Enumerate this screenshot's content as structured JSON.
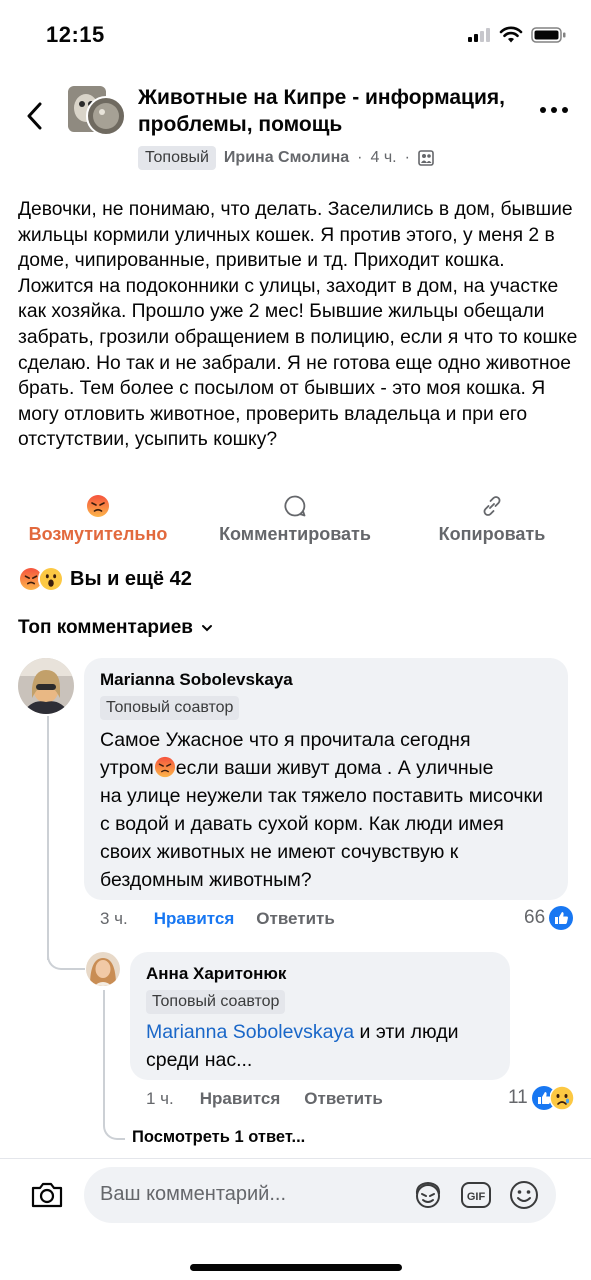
{
  "status_bar": {
    "time": "12:15"
  },
  "header": {
    "group_title": "Животные на Кипре - информация, проблемы, помощь",
    "badge": "Топовый",
    "author": "Ирина Смолина",
    "dot": "·",
    "time": "4 ч.",
    "icons": {
      "back": "chevron-left-icon",
      "more": "more-dots-icon",
      "audience": "group-audience-icon"
    }
  },
  "post": {
    "text": "Девочки, не понимаю, что делать. Заселились в дом, бывшие жильцы кормили уличных кошек. Я против этого, у меня 2 в доме, чипированные, привитые и тд. Приходит кошка. Ложится на подоконники с улицы, заходит в дом, на участке как хозяйка. Прошло уже 2 мес! Бывшие жильцы обещали забрать, грозили обращением в полицию, если я что то кошке сделаю. Но так и не забрали. Я не готова еще одно животное брать. Тем более с посылом от бывших - это моя кошка. Я могу отловить животное, проверить владельца и при его отстутствии, усыпить кошку?"
  },
  "actions": {
    "react": "Возмутительно",
    "comment": "Комментировать",
    "copy": "Копировать"
  },
  "reactions_summary": "Вы и ещё 42",
  "comments_filter": "Топ комментариев",
  "comments": [
    {
      "author": "Marianna Sobolevskaya",
      "badge": "Топовый соавтор",
      "line1": "Самое Ужасное что я прочитала сегодня",
      "line2_pre": "утром",
      "line2_post": "если ваши живут дома . А уличные",
      "line_rest": "на улице неужели так тяжело поставить мисочки с водой и давать сухой корм.  Как люди имея своих животных не имеют сочувствую к бездомным животным?",
      "time": "3 ч.",
      "like": "Нравится",
      "reply": "Ответить",
      "count": "66"
    },
    {
      "author": "Анна Харитонюк",
      "badge": "Топовый соавтор",
      "mention": "Marianna Sobolevskaya",
      "text": " и эти люди среди нас...",
      "time": "1 ч.",
      "like": "Нравится",
      "reply": "Ответить",
      "count": "11"
    }
  ],
  "more_replies": "Посмотреть 1 ответ...",
  "composer": {
    "placeholder": "Ваш комментарий..."
  },
  "colors": {
    "accent_blue": "#1877f2",
    "angry_orange": "#e2693d",
    "bubble_bg": "#f0f2f5",
    "secondary_text": "#65676b"
  }
}
